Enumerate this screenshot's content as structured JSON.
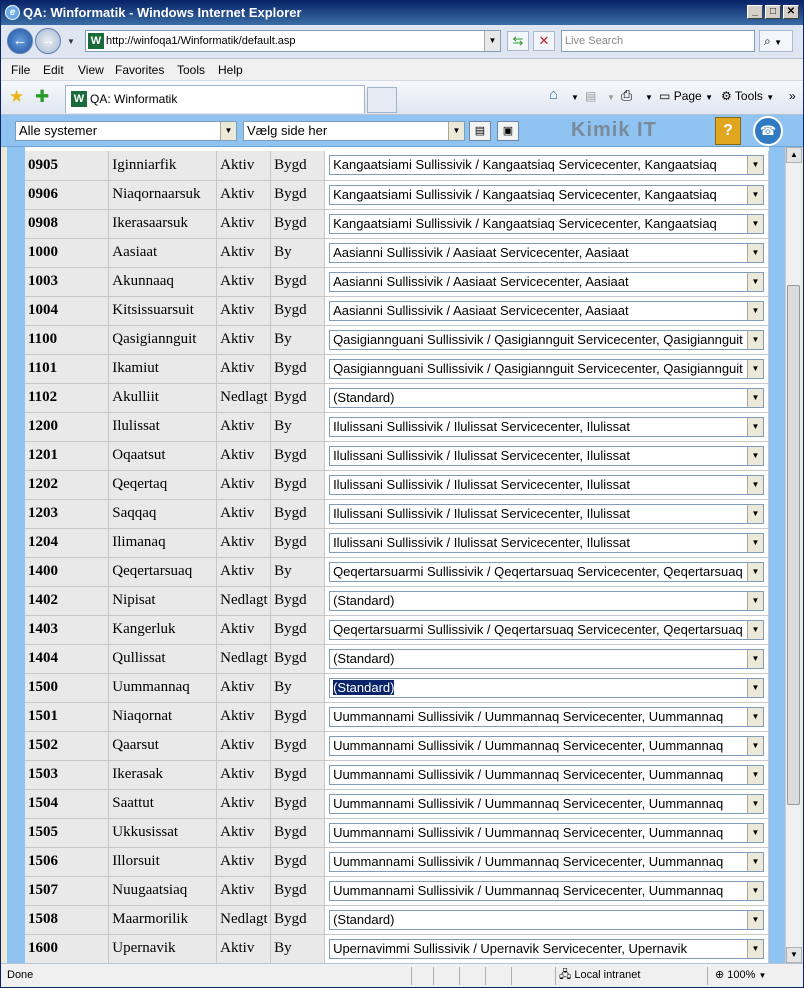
{
  "window": {
    "title": "QA: Winformatik   - Windows Internet Explorer"
  },
  "address": {
    "url": "http://winfoqa1/Winformatik/default.asp"
  },
  "search": {
    "placeholder": "Live Search"
  },
  "menu": [
    "File",
    "Edit",
    "View",
    "Favorites",
    "Tools",
    "Help"
  ],
  "tab": {
    "title": "QA: Winformatik"
  },
  "commands": {
    "page": "Page",
    "tools": "Tools"
  },
  "appbar": {
    "system_select": "Alle systemer",
    "page_select": "Vælg side her",
    "brand": "Kimik IT",
    "help": "?"
  },
  "rows": [
    {
      "code": "0905",
      "name": "Iginniarfik",
      "status": "Aktiv",
      "type": "Bygd",
      "center": "Kangaatsiami Sullissivik / Kangaatsiaq Servicecenter, Kangaatsiaq"
    },
    {
      "code": "0906",
      "name": "Niaqornaarsuk",
      "status": "Aktiv",
      "type": "Bygd",
      "center": "Kangaatsiami Sullissivik / Kangaatsiaq Servicecenter, Kangaatsiaq"
    },
    {
      "code": "0908",
      "name": "Ikerasaarsuk",
      "status": "Aktiv",
      "type": "Bygd",
      "center": "Kangaatsiami Sullissivik / Kangaatsiaq Servicecenter, Kangaatsiaq"
    },
    {
      "code": "1000",
      "name": "Aasiaat",
      "status": "Aktiv",
      "type": "By",
      "center": "Aasianni Sullissivik / Aasiaat Servicecenter, Aasiaat"
    },
    {
      "code": "1003",
      "name": "Akunnaaq",
      "status": "Aktiv",
      "type": "Bygd",
      "center": "Aasianni Sullissivik / Aasiaat Servicecenter, Aasiaat"
    },
    {
      "code": "1004",
      "name": "Kitsissuarsuit",
      "status": "Aktiv",
      "type": "Bygd",
      "center": "Aasianni Sullissivik / Aasiaat Servicecenter, Aasiaat"
    },
    {
      "code": "1100",
      "name": "Qasigiannguit",
      "status": "Aktiv",
      "type": "By",
      "center": "Qasigiannguani Sullissivik / Qasigiannguit Servicecenter, Qasigiannguit"
    },
    {
      "code": "1101",
      "name": "Ikamiut",
      "status": "Aktiv",
      "type": "Bygd",
      "center": "Qasigiannguani Sullissivik / Qasigiannguit Servicecenter, Qasigiannguit"
    },
    {
      "code": "1102",
      "name": "Akulliit",
      "status": "Nedlagt",
      "type": "Bygd",
      "center": "(Standard)"
    },
    {
      "code": "1200",
      "name": "Ilulissat",
      "status": "Aktiv",
      "type": "By",
      "center": "Ilulissani Sullissivik / Ilulissat Servicecenter, Ilulissat"
    },
    {
      "code": "1201",
      "name": "Oqaatsut",
      "status": "Aktiv",
      "type": "Bygd",
      "center": "Ilulissani Sullissivik / Ilulissat Servicecenter, Ilulissat"
    },
    {
      "code": "1202",
      "name": "Qeqertaq",
      "status": "Aktiv",
      "type": "Bygd",
      "center": "Ilulissani Sullissivik / Ilulissat Servicecenter, Ilulissat"
    },
    {
      "code": "1203",
      "name": "Saqqaq",
      "status": "Aktiv",
      "type": "Bygd",
      "center": "Ilulissani Sullissivik / Ilulissat Servicecenter, Ilulissat"
    },
    {
      "code": "1204",
      "name": "Ilimanaq",
      "status": "Aktiv",
      "type": "Bygd",
      "center": "Ilulissani Sullissivik / Ilulissat Servicecenter, Ilulissat"
    },
    {
      "code": "1400",
      "name": "Qeqertarsuaq",
      "status": "Aktiv",
      "type": "By",
      "center": "Qeqertarsuarmi Sullissivik / Qeqertarsuaq Servicecenter, Qeqertarsuaq"
    },
    {
      "code": "1402",
      "name": "Nipisat",
      "status": "Nedlagt",
      "type": "Bygd",
      "center": "(Standard)"
    },
    {
      "code": "1403",
      "name": "Kangerluk",
      "status": "Aktiv",
      "type": "Bygd",
      "center": "Qeqertarsuarmi Sullissivik / Qeqertarsuaq Servicecenter, Qeqertarsuaq"
    },
    {
      "code": "1404",
      "name": "Qullissat",
      "status": "Nedlagt",
      "type": "Bygd",
      "center": "(Standard)"
    },
    {
      "code": "1500",
      "name": "Uummannaq",
      "status": "Aktiv",
      "type": "By",
      "center": "(Standard)",
      "focused": true
    },
    {
      "code": "1501",
      "name": "Niaqornat",
      "status": "Aktiv",
      "type": "Bygd",
      "center": "Uummannami Sullissivik / Uummannaq Servicecenter, Uummannaq"
    },
    {
      "code": "1502",
      "name": "Qaarsut",
      "status": "Aktiv",
      "type": "Bygd",
      "center": "Uummannami Sullissivik / Uummannaq Servicecenter, Uummannaq"
    },
    {
      "code": "1503",
      "name": "Ikerasak",
      "status": "Aktiv",
      "type": "Bygd",
      "center": "Uummannami Sullissivik / Uummannaq Servicecenter, Uummannaq"
    },
    {
      "code": "1504",
      "name": "Saattut",
      "status": "Aktiv",
      "type": "Bygd",
      "center": "Uummannami Sullissivik / Uummannaq Servicecenter, Uummannaq"
    },
    {
      "code": "1505",
      "name": "Ukkusissat",
      "status": "Aktiv",
      "type": "Bygd",
      "center": "Uummannami Sullissivik / Uummannaq Servicecenter, Uummannaq"
    },
    {
      "code": "1506",
      "name": "Illorsuit",
      "status": "Aktiv",
      "type": "Bygd",
      "center": "Uummannami Sullissivik / Uummannaq Servicecenter, Uummannaq"
    },
    {
      "code": "1507",
      "name": "Nuugaatsiaq",
      "status": "Aktiv",
      "type": "Bygd",
      "center": "Uummannami Sullissivik / Uummannaq Servicecenter, Uummannaq"
    },
    {
      "code": "1508",
      "name": "Maarmorilik",
      "status": "Nedlagt",
      "type": "Bygd",
      "center": "(Standard)"
    },
    {
      "code": "1600",
      "name": "Upernavik",
      "status": "Aktiv",
      "type": "By",
      "center": "Upernavimmi Sullissivik / Upernavik Servicecenter, Upernavik"
    }
  ],
  "statusbar": {
    "text": "Done",
    "zone": "Local intranet",
    "zoom": "100%"
  },
  "colors": {
    "accent": "#8fc4f2",
    "title_bar": "#0a246a",
    "focus_highlight": "#0a246a"
  }
}
